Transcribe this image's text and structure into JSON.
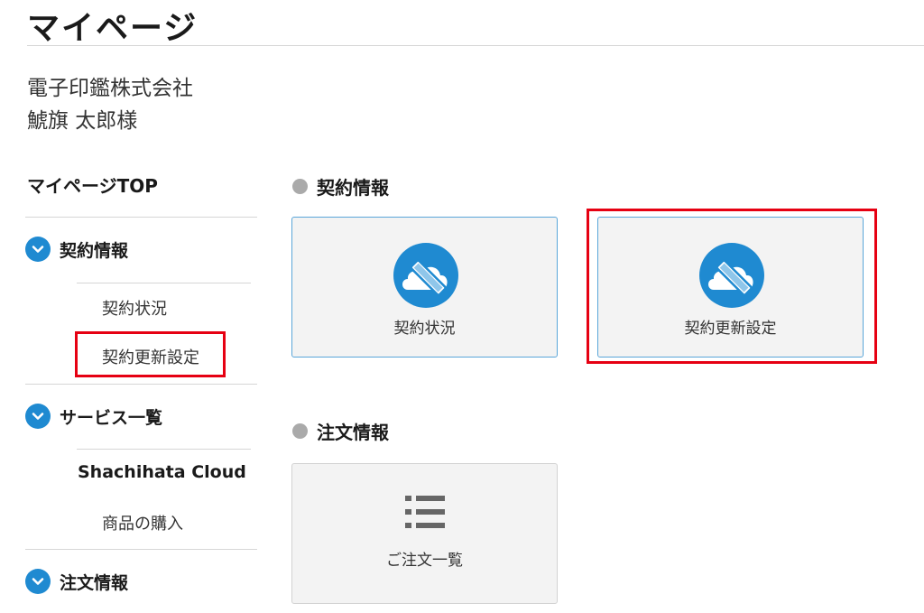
{
  "page": {
    "title": "マイページ"
  },
  "customer": {
    "company": "電子印鑑株式会社",
    "name": "鯱旗 太郎様"
  },
  "sidebar": {
    "top": "マイページTOP",
    "sections": [
      {
        "label": "契約情報",
        "items": [
          "契約状況",
          "契約更新設定"
        ]
      },
      {
        "label": "サービス一覧",
        "items": [
          "Shachihata Cloud",
          "商品の購入"
        ]
      },
      {
        "label": "注文情報",
        "items": []
      }
    ]
  },
  "main": {
    "contract": {
      "title": "契約情報",
      "cards": [
        {
          "label": "契約状況",
          "icon": "cloud-pen-icon"
        },
        {
          "label": "契約更新設定",
          "icon": "cloud-pen-icon"
        }
      ]
    },
    "orders": {
      "title": "注文情報",
      "cards": [
        {
          "label": "ご注文一覧",
          "icon": "list-icon"
        }
      ]
    }
  },
  "colors": {
    "accent": "#1f8ad1",
    "highlight": "#e60012",
    "card_bg": "#f3f3f3"
  }
}
